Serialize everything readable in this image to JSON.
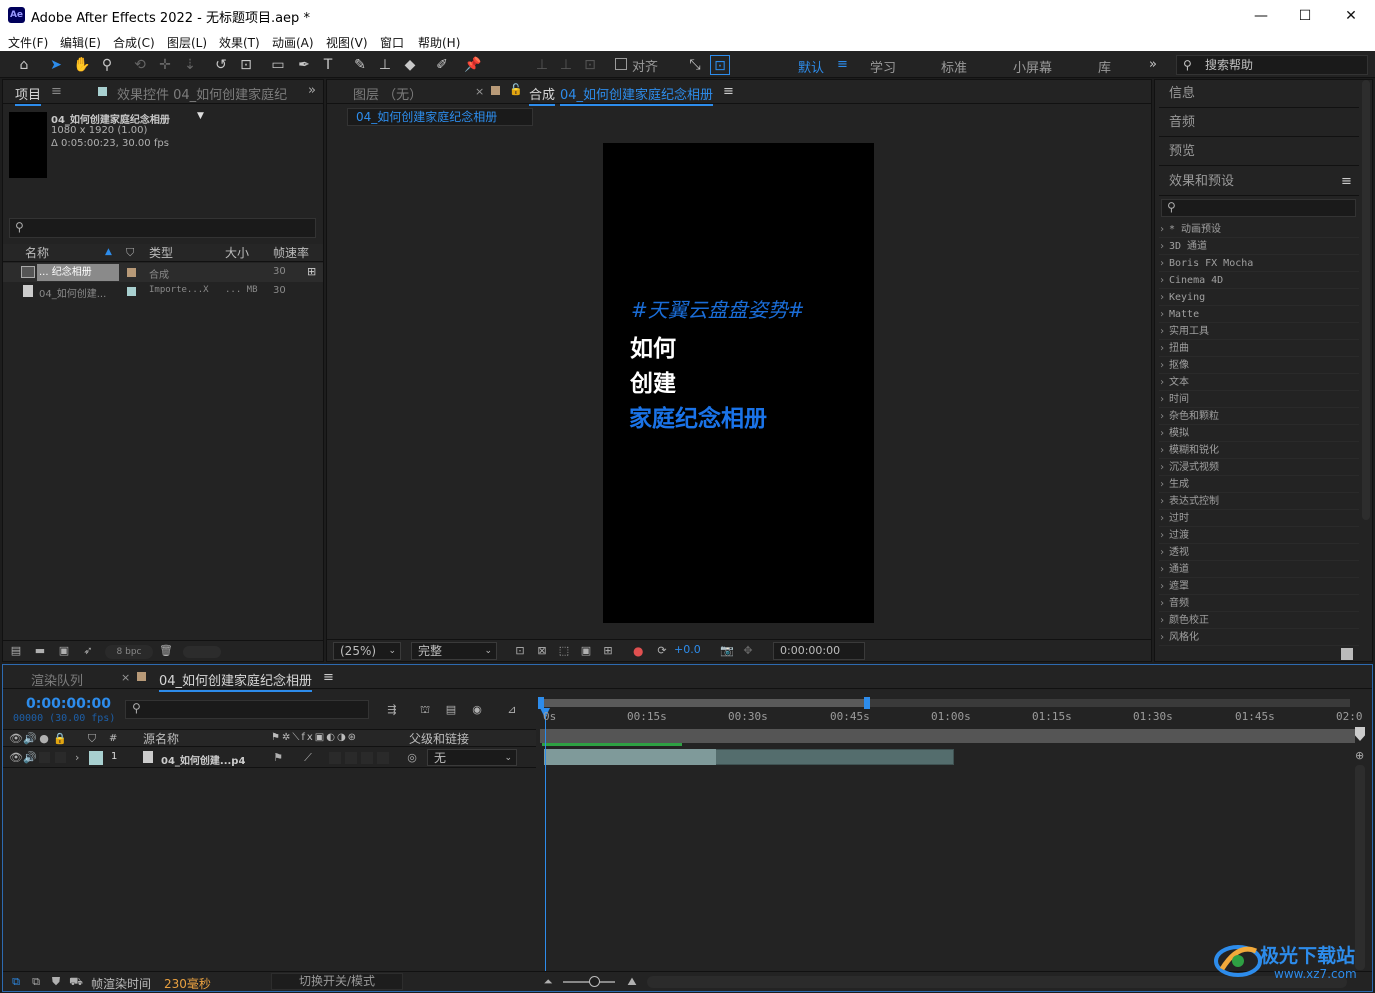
{
  "window": {
    "title": "Adobe After Effects 2022 - 无标题项目.aep *",
    "app_icon": "Ae",
    "minimize": "—",
    "maximize": "☐",
    "close": "✕"
  },
  "menu": [
    "文件(F)",
    "编辑(E)",
    "合成(C)",
    "图层(L)",
    "效果(T)",
    "动画(A)",
    "视图(V)",
    "窗口",
    "帮助(H)"
  ],
  "toolbar": {
    "align_label": "对齐",
    "workspaces": [
      "默认",
      "学习",
      "标准",
      "小屏幕",
      "库"
    ],
    "workspace_menu_icon": "≡",
    "more_icon": "»",
    "search_help": "搜索帮助"
  },
  "project_panel": {
    "tab_project": "项目",
    "tab_effects": "效果控件 04_如何创建家庭纪",
    "comp_name": "04_如何创建家庭纪念相册",
    "comp_res": "1080 x 1920 (1.00)",
    "comp_dur": "Δ 0:05:00:23, 30.00 fps",
    "columns": [
      "名称",
      "类型",
      "大小",
      "帧速率"
    ],
    "rows": [
      {
        "name": "... 纪念相册",
        "type": "合成",
        "size": "",
        "fps": "30"
      },
      {
        "name": "04_如何创建...",
        "type": "Importe...X",
        "size": "... MB",
        "fps": "30"
      }
    ],
    "bpc": "8 bpc"
  },
  "viewer": {
    "tab_layer": "图层 （无）",
    "tab_comp_prefix": "合成",
    "tab_comp_name": "04_如何创建家庭纪念相册",
    "breadcrumb": "04_如何创建家庭纪念相册",
    "canvas_text": [
      "#天翼云盘盘姿势#",
      "如何",
      "创建",
      "家庭纪念相册"
    ],
    "zoom": "(25%)",
    "resolution": "完整",
    "exposure": "+0.0",
    "timecode": "0:00:00:00"
  },
  "right_panel": {
    "sections": [
      "信息",
      "音频",
      "预览",
      "效果和预设"
    ],
    "effects": [
      "* 动画预设",
      "3D 通道",
      "Boris FX Mocha",
      "Cinema 4D",
      "Keying",
      "Matte",
      "实用工具",
      "扭曲",
      "抠像",
      "文本",
      "时间",
      "杂色和颗粒",
      "模拟",
      "模糊和锐化",
      "沉浸式视频",
      "生成",
      "表达式控制",
      "过时",
      "过渡",
      "透视",
      "通道",
      "遮罩",
      "音频",
      "颜色校正",
      "风格化"
    ]
  },
  "timeline": {
    "tab_render": "渲染队列",
    "tab_comp": "04_如何创建家庭纪念相册",
    "timecode": "0:00:00:00",
    "frames": "00000 (30.00 fps)",
    "columns": {
      "num": "#",
      "source": "源名称",
      "parent": "父级和链接"
    },
    "layer": {
      "index": "1",
      "name": "04_如何创建...p4",
      "parent": "无"
    },
    "ticks": [
      "0s",
      "00:15s",
      "00:30s",
      "00:45s",
      "01:00s",
      "01:15s",
      "01:30s",
      "01:45s",
      "02:0"
    ],
    "footer_label": "帧渲染时间",
    "footer_value": "230毫秒",
    "footer_mode": "切换开关/模式"
  },
  "watermark": {
    "text": "极光下载站",
    "url": "www.xz7.com"
  }
}
